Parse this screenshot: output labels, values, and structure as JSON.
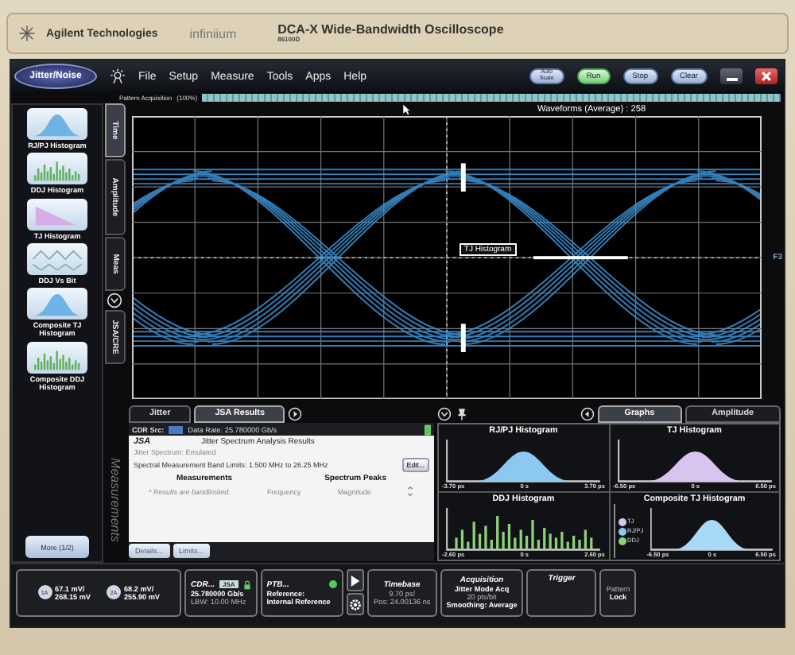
{
  "brand": {
    "company": "Agilent Technologies",
    "product_line": "infiniium",
    "title": "DCA-X Wide-Bandwidth Oscilloscope",
    "model": "86100D"
  },
  "app_button": "Jitter/Noise",
  "menu": [
    "File",
    "Setup",
    "Measure",
    "Tools",
    "Apps",
    "Help"
  ],
  "toolbar_buttons": [
    {
      "label": "Auto Scale",
      "kind": "auto"
    },
    {
      "label": "Run",
      "kind": "run"
    },
    {
      "label": "Stop",
      "kind": "plain"
    },
    {
      "label": "Clear",
      "kind": "plain"
    }
  ],
  "progress": {
    "label": "Pattern Acquisition",
    "percent": "(100%)",
    "level": 1
  },
  "sidebar": {
    "items": [
      {
        "label": "RJ/PJ Histogram",
        "kind": "bell"
      },
      {
        "label": "DDJ Histogram",
        "kind": "bars"
      },
      {
        "label": "TJ Histogram",
        "kind": "slope"
      },
      {
        "label": "DDJ Vs Bit",
        "kind": "steps"
      },
      {
        "label": "Composite TJ Histogram",
        "kind": "bell"
      },
      {
        "label": "Composite DDJ Histogram",
        "kind": "bars"
      }
    ],
    "more": "More (1/2)"
  },
  "vertical_tabs": [
    {
      "label": "Time",
      "selected": true
    },
    {
      "label": "Amplitude",
      "selected": false
    },
    {
      "label": "Meas",
      "selected": false
    },
    {
      "label": "JSA/CRE",
      "selected": false
    }
  ],
  "measurements_label": "Measurements",
  "waveform": {
    "counter": "Waveforms (Average) : 258",
    "marker_label": "TJ Histogram",
    "channel_tag": "F3"
  },
  "panel_left": {
    "tabs": [
      {
        "label": "Jitter",
        "selected": false
      },
      {
        "label": "JSA Results",
        "selected": true
      }
    ],
    "cdr_source_label": "CDR Src:",
    "data_rate": "Data Rate: 25.780000 Gb/s",
    "card": {
      "tag": "JSA",
      "title": "Jitter Spectrum Analysis Results",
      "spectrum": "Jitter Spectrum: Emulated",
      "band_limits": "Spectral Measurement Band Limits: 1.500 MHz to 26.25 MHz",
      "edit": "Edit...",
      "measurements": "Measurements",
      "spectrum_peaks": "Spectrum Peaks",
      "note": "* Results are bandlimited.",
      "frequency": "Frequency",
      "magnitude": "Magnitude"
    },
    "buttons": [
      "Details...",
      "Limits..."
    ]
  },
  "panel_right": {
    "tabs": [
      {
        "label": "Graphs",
        "selected": true
      },
      {
        "label": "Amplitude",
        "selected": false
      }
    ],
    "histograms": [
      {
        "title": "RJ/PJ Histogram",
        "kind": "bell",
        "color": "#8cc8f0",
        "ticks": [
          "-3.70 ps",
          "0 s",
          "3.70 ps"
        ]
      },
      {
        "title": "TJ Histogram",
        "kind": "bell",
        "color": "#d8c4ee",
        "ticks": [
          "-6.50 ps",
          "0 s",
          "6.50 ps"
        ]
      },
      {
        "title": "DDJ Histogram",
        "kind": "bars",
        "color": "#8fd07a",
        "ticks": [
          "-2.60 ps",
          "0 s",
          "2.60 ps"
        ]
      },
      {
        "title": "Composite TJ Histogram",
        "kind": "composite",
        "color": "#a8d8f8",
        "ticks": [
          "-6.50 ps",
          "0 s",
          "6.50 ps"
        ],
        "legend": [
          {
            "label": "TJ",
            "color": "#d8c4ee"
          },
          {
            "label": "RJ/PJ",
            "color": "#8cc8f0"
          },
          {
            "label": "DDJ",
            "color": "#8fd07a"
          }
        ]
      }
    ]
  },
  "status_bar": {
    "channels": [
      {
        "label": "1A",
        "scale": "67.1 mV/",
        "offset": "268.15 mV"
      },
      {
        "label": "2A",
        "scale": "68.2 mV/",
        "offset": "255.90 mV"
      }
    ],
    "cdr": {
      "title": "CDR...",
      "badge": "JSA",
      "rate": "25.780000 Gb/s",
      "lbw": "LBW: 10.00 MHz"
    },
    "ptb": {
      "title": "PTB...",
      "line1": "Reference:",
      "line2": "Internal Reference"
    },
    "timebase": {
      "title": "Timebase",
      "scale": "9.70 ps/",
      "position": "Pos: 24.00136 ns"
    },
    "acquisition": {
      "title": "Acquisition",
      "mode": "Jitter Mode Acq",
      "rate": "20 pts/bit",
      "smoothing": "Smoothing: Average"
    },
    "trigger": {
      "title": "Trigger"
    },
    "pattern": {
      "title": "Pattern",
      "value": "Lock"
    }
  }
}
